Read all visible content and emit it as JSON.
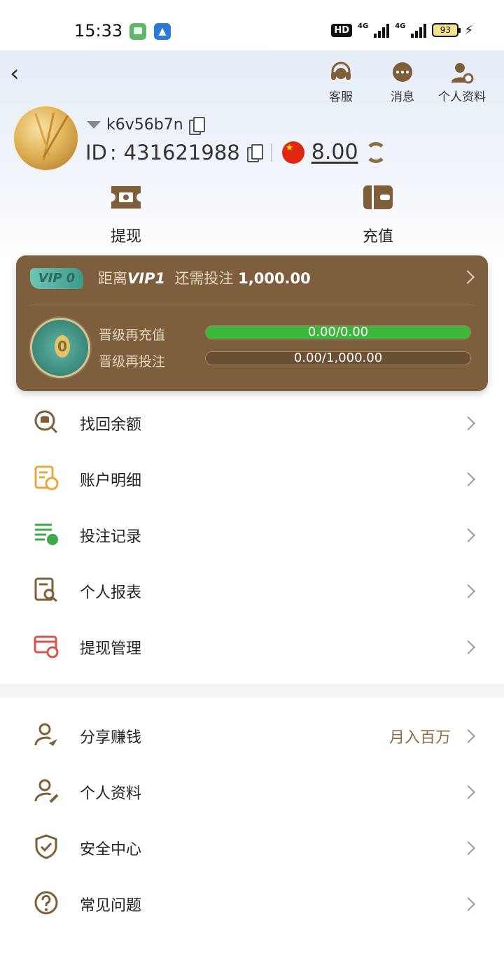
{
  "status_bar": {
    "time": "15:33",
    "hd": "HD",
    "net1": "4G",
    "net2": "4G",
    "battery": "93"
  },
  "header": {
    "top_actions": [
      {
        "label": "客服",
        "icon": "headset-icon"
      },
      {
        "label": "消息",
        "icon": "chat-icon"
      },
      {
        "label": "个人资料",
        "icon": "user-settings-icon"
      }
    ],
    "username": "k6v56b7n",
    "id_prefix": "ID",
    "id_value": "431621988",
    "balance": "8.00",
    "actions": [
      {
        "label": "提现",
        "icon": "withdraw-icon"
      },
      {
        "label": "充值",
        "icon": "wallet-icon"
      }
    ]
  },
  "vip": {
    "badge": "VIP 0",
    "prefix": "距离",
    "next_level": "VIP1",
    "need_text": "还需投注",
    "need_amount": "1,000.00",
    "medal_level": "0",
    "rows": [
      {
        "label": "晋级再充值",
        "value": "0.00/0.00",
        "progress": 1.0
      },
      {
        "label": "晋级再投注",
        "value": "0.00/1,000.00",
        "progress": 0.0
      }
    ]
  },
  "menu1": [
    {
      "label": "找回余额",
      "icon": "coin-search-icon"
    },
    {
      "label": "账户明细",
      "icon": "account-detail-icon"
    },
    {
      "label": "投注记录",
      "icon": "bet-record-icon"
    },
    {
      "label": "个人报表",
      "icon": "report-icon"
    },
    {
      "label": "提现管理",
      "icon": "withdraw-manage-icon"
    }
  ],
  "menu2": [
    {
      "label": "分享赚钱",
      "icon": "share-user-icon",
      "extra": "月入百万"
    },
    {
      "label": "个人资料",
      "icon": "user-edit-icon"
    },
    {
      "label": "安全中心",
      "icon": "shield-check-icon"
    },
    {
      "label": "常见问题",
      "icon": "question-icon"
    }
  ],
  "colors": {
    "accent": "#7d5f3d",
    "progress": "#3bb73b",
    "header_bg": "#e6edf7"
  }
}
